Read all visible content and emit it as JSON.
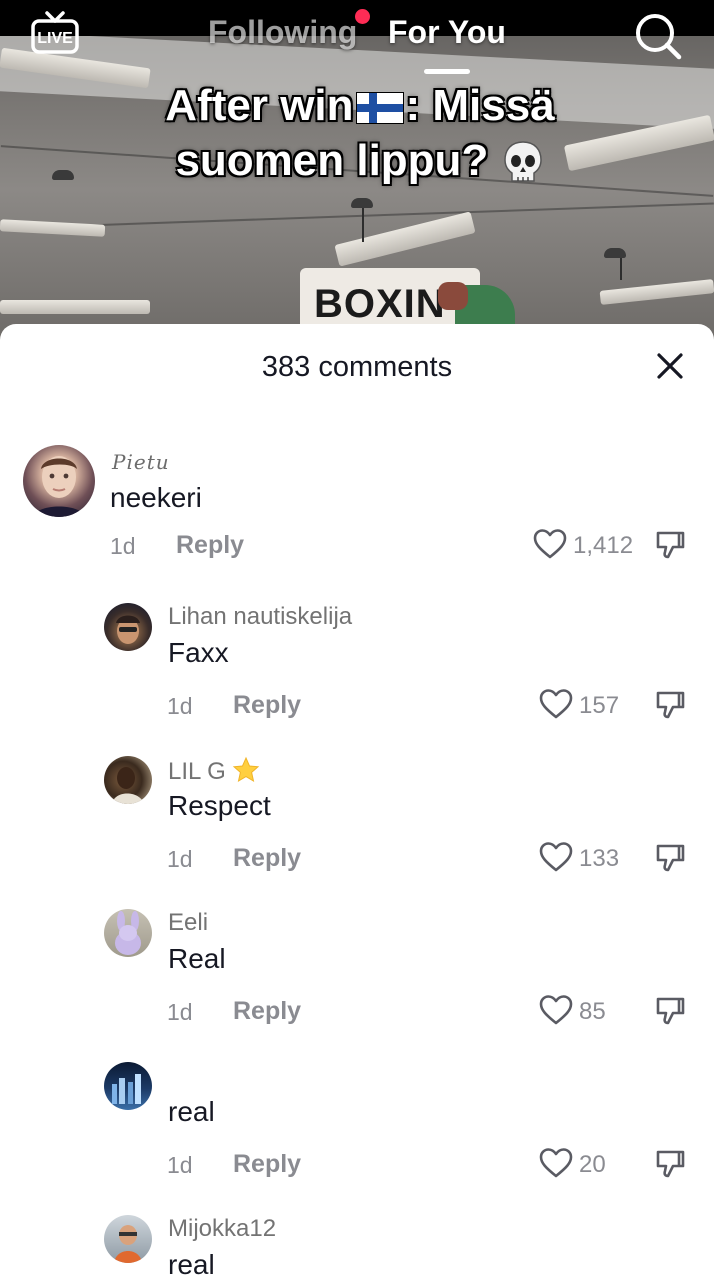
{
  "topnav": {
    "live_label": "LIVE",
    "following_label": "Following",
    "foryou_label": "For You"
  },
  "caption": {
    "part1": "After win",
    "part2": ": Missä",
    "part3": "suomen lippu?"
  },
  "video": {
    "sign_text": "BOXIN"
  },
  "comments_sheet": {
    "title": "383 comments",
    "comments": [
      {
        "username": "Pietu",
        "text": "neekeri",
        "date": "1d",
        "reply_label": "Reply",
        "likes": "1,412"
      },
      {
        "username": "Lihan nautiskelija",
        "text": "Faxx",
        "date": "1d",
        "reply_label": "Reply",
        "likes": "157"
      },
      {
        "username": "LIL G",
        "text": "Respect",
        "date": "1d",
        "reply_label": "Reply",
        "likes": "133"
      },
      {
        "username": "Eeli",
        "text": "Real",
        "date": "1d",
        "reply_label": "Reply",
        "likes": "85"
      },
      {
        "username": "",
        "text": "real",
        "date": "1d",
        "reply_label": "Reply",
        "likes": "20"
      },
      {
        "username": "Mijokka12",
        "text": "real",
        "date": "",
        "reply_label": "",
        "likes": ""
      }
    ]
  },
  "colors": {
    "accent_red": "#fe2c55",
    "text_primary": "#161823",
    "text_secondary": "#8a8b91"
  }
}
